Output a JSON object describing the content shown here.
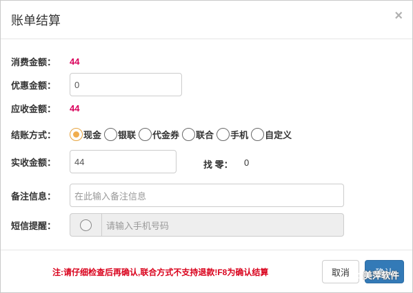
{
  "dialog": {
    "title": "账单结算",
    "close_icon": "×"
  },
  "form": {
    "consume_amount": {
      "label": "消费金额：",
      "value": "44"
    },
    "discount_amount": {
      "label": "优惠金额：",
      "value": "0"
    },
    "receivable_amount": {
      "label": "应收金额：",
      "value": "44"
    },
    "payment_method": {
      "label": "结账方式：",
      "options": [
        {
          "label": "现金",
          "selected": true
        },
        {
          "label": "银联",
          "selected": false
        },
        {
          "label": "代金券",
          "selected": false
        },
        {
          "label": "联合",
          "selected": false
        },
        {
          "label": "手机",
          "selected": false
        },
        {
          "label": "自定义",
          "selected": false
        }
      ]
    },
    "received_amount": {
      "label": "实收金额：",
      "value": "44"
    },
    "change": {
      "label": "找 零：",
      "value": "0"
    },
    "remark": {
      "label": "备注信息：",
      "placeholder": "在此输入备注信息"
    },
    "sms": {
      "label": "短信提醒：",
      "placeholder": "请输入手机号码"
    }
  },
  "footer": {
    "note": "注:请仔细检查后再确认,联合方式不支持退款!F8为确认结算",
    "cancel_label": "取消",
    "confirm_label": "确认"
  },
  "watermark": {
    "text": "美萍软件",
    "icon": "wechat-icon"
  },
  "colors": {
    "accent_red": "#d9005b",
    "note_red": "#d9001b",
    "primary_blue": "#337ab7",
    "radio_selected": "#f0ad4e"
  }
}
